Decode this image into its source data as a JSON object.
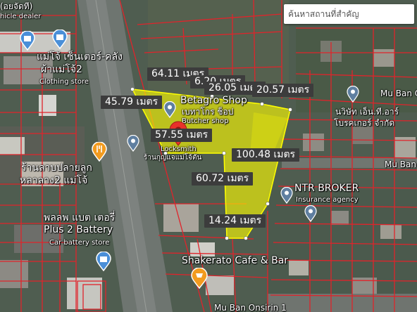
{
  "search": {
    "placeholder": "ค้นหาสถานที่สำคัญ"
  },
  "pois": {
    "dealer_fragment_top": "(อยจัดที)",
    "dealer_fragment_sub": "hicle dealer",
    "clothing_name_1": "แม่โจ้ เซ็นเตอร์-คลัง",
    "clothing_name_2": "ผ้าแม่โจ้2",
    "clothing_sub": "Clothing store",
    "betagro_name": "Betagro Shop",
    "betagro_thai": "เบทาโกร ช็อป",
    "betagro_sub": "Butcher shop",
    "locksmith_thai_top": "ร้าน...",
    "locksmith_sub": "Locksmith",
    "locksmith_thai": "ร้านกุญแจแม่โจ้ตัน",
    "ntr_name": "NTR BROKER",
    "ntr_sub": "Insurance agency",
    "nakhon_thai_1": "นวิษัท เอ็น.ที.อาร์",
    "nakhon_thai_2": "โบรคเกอร์ จำกัด",
    "shop_thai_1": "ร้านลาบปลายลูก",
    "shop_thai_2": "หลาลาง2 แม่โจ้",
    "battery_name_1": "พลลพ แบต เตอรี่",
    "battery_name_2": "Plus 2 Battery",
    "battery_sub": "Car battery store",
    "cafe_name": "Shakerato Cafe & Bar",
    "road_moo_ban_1": "Mu Ban O",
    "road_moo_ban_2": "Mu Ban",
    "road_bottom": "Mu Ban Onsirin 1"
  },
  "measurements": [
    {
      "id": "m1",
      "text": "64.11 เมตร"
    },
    {
      "id": "m2",
      "text": "6.20 เมตร"
    },
    {
      "id": "m3",
      "text": "26.05 เมตร"
    },
    {
      "id": "m4",
      "text": "20.57 เมตร"
    },
    {
      "id": "m5",
      "text": "45.79 เมตร"
    },
    {
      "id": "m6",
      "text": "57.55 เมตร"
    },
    {
      "id": "m7",
      "text": "100.48 เมตร"
    },
    {
      "id": "m8",
      "text": "60.72 เมตร"
    },
    {
      "id": "m9",
      "text": "14.24 เมตร"
    }
  ],
  "colors": {
    "parcel_line": "#e0242b",
    "highlight": "#ffff00",
    "pin_red": "#e8312a",
    "poi_gray": "#5f7fa0",
    "food_orange": "#f29b1f",
    "shop_blue": "#4a8fd8"
  }
}
